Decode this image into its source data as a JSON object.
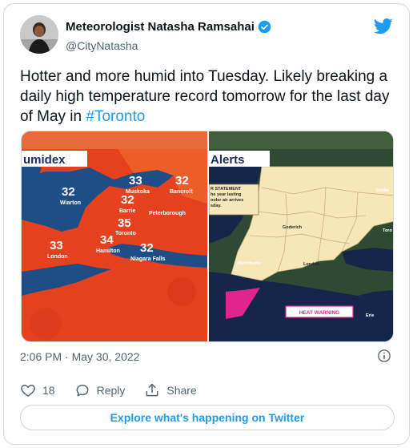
{
  "author": {
    "display_name": "Meteorologist Natasha Ramsahai",
    "handle": "@CityNatasha"
  },
  "tweet": {
    "text_before_hashtag": "Hotter and more humid into Tuesday. Likely breaking a daily high temperature record tomorrow for the last day of May in ",
    "hashtag": "#Toronto"
  },
  "media": {
    "left_panel": {
      "title": "umidex",
      "readings": [
        {
          "value": "33",
          "place": "Muskoka"
        },
        {
          "value": "32",
          "place": "Bancroft"
        },
        {
          "value": "32",
          "place": "Wiarton"
        },
        {
          "value": "32",
          "place": "Barrie"
        },
        {
          "value": "",
          "place": "Peterborough"
        },
        {
          "value": "35",
          "place": "Toronto"
        },
        {
          "value": "34",
          "place": "Hamilton"
        },
        {
          "value": "33",
          "place": "London"
        },
        {
          "value": "32",
          "place": "Niagara Falls"
        }
      ]
    },
    "right_panel": {
      "title": "Alerts",
      "statement_lines": [
        "R STATEMENT",
        "he year lasting",
        "ooler air arrives",
        "sday."
      ],
      "places": [
        "Orillia",
        "Goderich",
        "Toro",
        "Port Huron",
        "London",
        "Erie"
      ],
      "warning_label": "HEAT WARNING"
    }
  },
  "meta": {
    "time": "2:06 PM",
    "separator": "·",
    "date": "May 30, 2022"
  },
  "actions": {
    "like_count": "18",
    "reply_label": "Reply",
    "share_label": "Share"
  },
  "explore_label": "Explore what's happening on Twitter",
  "colors": {
    "accent": "#1d9bf0",
    "heat_red": "#e63a1f",
    "warning_pink": "#e0268c"
  }
}
